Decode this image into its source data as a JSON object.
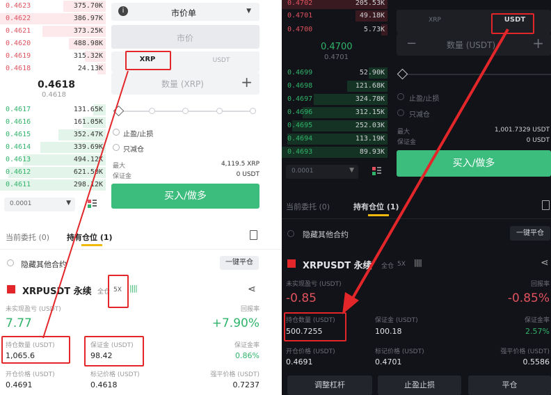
{
  "left": {
    "asks": [
      {
        "price": "0.4623",
        "qty": "375.70K"
      },
      {
        "price": "0.4622",
        "qty": "386.97K"
      },
      {
        "price": "0.4621",
        "qty": "373.25K"
      },
      {
        "price": "0.4620",
        "qty": "488.98K"
      },
      {
        "price": "0.4619",
        "qty": "315.32K"
      },
      {
        "price": "0.4618",
        "qty": "24.13K"
      }
    ],
    "last_price": "0.4618",
    "mark_price": "0.4618",
    "bids": [
      {
        "price": "0.4617",
        "qty": "131.65K"
      },
      {
        "price": "0.4616",
        "qty": "161.05K"
      },
      {
        "price": "0.4615",
        "qty": "352.47K"
      },
      {
        "price": "0.4614",
        "qty": "339.69K"
      },
      {
        "price": "0.4613",
        "qty": "494.12K"
      },
      {
        "price": "0.4612",
        "qty": "621.50K"
      },
      {
        "price": "0.4611",
        "qty": "298.12K"
      }
    ],
    "precision": "0.0001",
    "order_type": "市价单",
    "price_placeholder": "市价",
    "unit_tabs": [
      "XRP",
      "USDT"
    ],
    "qty_placeholder": "数量 (XRP)",
    "tpsl_label": "止盈/止损",
    "reduce_only_label": "只减仓",
    "max_label": "最大",
    "max_value": "4,119.5 XRP",
    "margin_label": "保证金",
    "margin_value": "0 USDT",
    "buy_button": "买入/做多",
    "tab_orders": "当前委托 (0)",
    "tab_positions": "持有仓位 (1)",
    "hide_other": "隐藏其他合约",
    "close_all": "一键平仓",
    "symbol": "XRPUSDT 永续",
    "margin_mode": "全仓",
    "leverage": "5X",
    "pnl_label": "未实现盈亏 (USDT)",
    "pnl_value": "7.77",
    "roe_label": "回报率",
    "roe_value": "+7.90%",
    "size_label": "持仓数量 (USDT)",
    "size_value": "1,065.6",
    "margin2_label": "保证金 (USDT)",
    "margin2_value": "98.42",
    "margin_ratio_label": "保证金率",
    "margin_ratio_value": "0.86%",
    "entry_label": "开仓价格 (USDT)",
    "entry_value": "0.4691",
    "mark_label": "标记价格 (USDT)",
    "mark_value": "0.4618",
    "liq_label": "强平价格 (USDT)",
    "liq_value": "0.7237"
  },
  "right": {
    "asks": [
      {
        "price": "0.4702",
        "qty": "205.53K"
      },
      {
        "price": "0.4701",
        "qty": "49.18K"
      },
      {
        "price": "0.4700",
        "qty": "5.73K"
      }
    ],
    "last_price": "0.4700",
    "mark_price": "0.4701",
    "bids": [
      {
        "price": "0.4699",
        "qty": "52.90K"
      },
      {
        "price": "0.4698",
        "qty": "121.68K"
      },
      {
        "price": "0.4697",
        "qty": "324.78K"
      },
      {
        "price": "0.4696",
        "qty": "312.15K"
      },
      {
        "price": "0.4695",
        "qty": "252.03K"
      },
      {
        "price": "0.4694",
        "qty": "113.19K"
      },
      {
        "price": "0.4693",
        "qty": "89.93K"
      }
    ],
    "precision": "0.0001",
    "unit_tabs": [
      "XRP",
      "USDT"
    ],
    "qty_placeholder": "数量 (USDT)",
    "tpsl_label": "止盈/止损",
    "reduce_only_label": "只减仓",
    "max_label": "最大",
    "max_value": "1,001.7329 USDT",
    "margin_label": "保证金",
    "margin_value": "0 USDT",
    "buy_button": "买入/做多",
    "tab_orders": "当前委托 (0)",
    "tab_positions": "持有仓位 (1)",
    "hide_other": "隐藏其他合约",
    "close_all": "一键平仓",
    "symbol": "XRPUSDT 永续",
    "margin_mode": "全仓",
    "leverage": "5X",
    "pnl_label": "未实现盈亏 (USDT)",
    "pnl_value": "-0.85",
    "roe_label": "回报率",
    "roe_value": "-0.85%",
    "size_label": "持仓数量 (USDT)",
    "size_value": "500.7255",
    "margin2_label": "保证金 (USDT)",
    "margin2_value": "100.18",
    "margin_ratio_label": "保证金率",
    "margin_ratio_value": "2.57%",
    "entry_label": "开仓价格 (USDT)",
    "entry_value": "0.4691",
    "mark_label": "标记价格 (USDT)",
    "mark_value": "0.4701",
    "liq_label": "强平价格 (USDT)",
    "liq_value": "0.5586",
    "btn_leverage": "调整杠杆",
    "btn_tpsl": "止盈止损",
    "btn_close": "平仓"
  },
  "colors": {
    "green": "#3dbd7d",
    "red": "#e0525f",
    "annotation_red": "#e3262a",
    "dark_bg": "#121318"
  }
}
